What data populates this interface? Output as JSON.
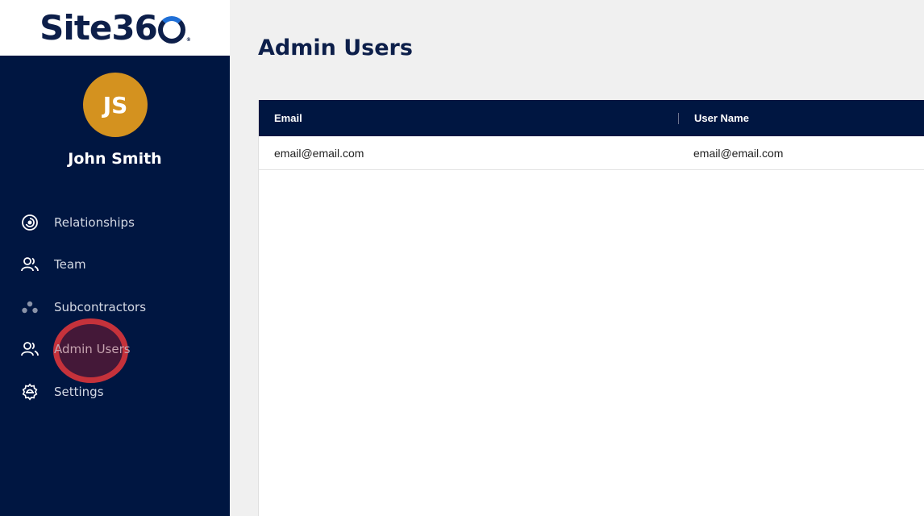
{
  "brand": {
    "logo_text": "Site36",
    "logo_reg": "®"
  },
  "user": {
    "initials": "JS",
    "name": "John Smith"
  },
  "sidebar": {
    "items": [
      {
        "label": "Relationships",
        "icon": "relationships-icon"
      },
      {
        "label": "Team",
        "icon": "team-icon"
      },
      {
        "label": "Subcontractors",
        "icon": "subcontractors-icon"
      },
      {
        "label": "Admin Users",
        "icon": "admin-users-icon",
        "active": true
      },
      {
        "label": "Settings",
        "icon": "settings-icon"
      }
    ]
  },
  "main": {
    "title": "Admin Users",
    "table": {
      "columns": [
        "Email",
        "User Name"
      ],
      "rows": [
        {
          "email": "email@email.com",
          "user_name": "email@email.com"
        }
      ]
    }
  },
  "colors": {
    "sidebar_bg": "#001641",
    "avatar_bg": "#d4921f",
    "header_bg": "#001641",
    "highlight": "#dc373c"
  }
}
